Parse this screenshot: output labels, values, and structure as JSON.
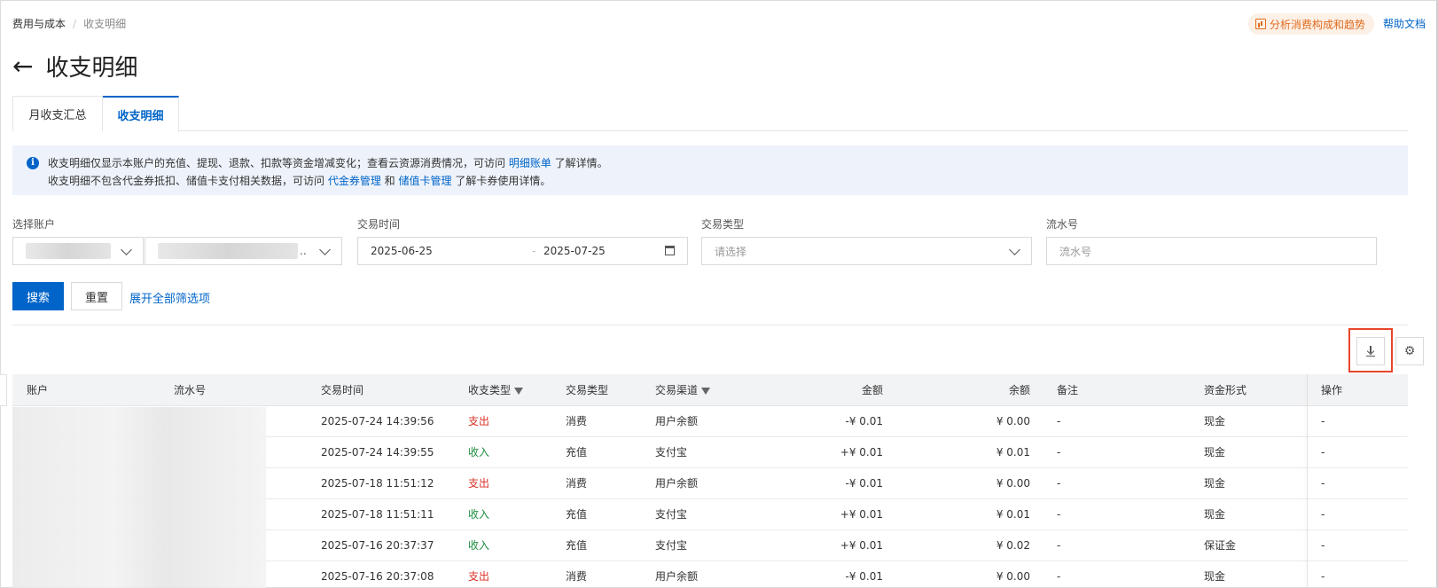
{
  "breadcrumb": {
    "parent": "费用与成本",
    "separator": "/",
    "current": "收支明细"
  },
  "header": {
    "analyze_label": "分析消费构成和趋势",
    "help_label": "帮助文档",
    "back_icon": "←",
    "title": "收支明细"
  },
  "tabs": [
    {
      "label": "月收支汇总",
      "active": false
    },
    {
      "label": "收支明细",
      "active": true
    }
  ],
  "notice": {
    "line1_before": "收支明细仅显示本账户的充值、提现、退款、扣款等资金增减变化；查看云资源消费情况，可访问 ",
    "line1_link": "明细账单",
    "line1_after": " 了解详情。",
    "line2_before": "收支明细不包含代金券抵扣、储值卡支付相关数据，可访问 ",
    "line2_link1": "代金券管理",
    "line2_mid": " 和 ",
    "line2_link2": "储值卡管理",
    "line2_after": " 了解卡券使用详情。"
  },
  "filters": {
    "account_label": "选择账户",
    "account_suffix": "..",
    "time_label": "交易时间",
    "start_date": "2025-06-25",
    "end_date": "2025-07-25",
    "range_sep": "-",
    "type_label": "交易类型",
    "type_placeholder": "请选择",
    "serial_label": "流水号",
    "serial_placeholder": "流水号"
  },
  "actions": {
    "search": "搜索",
    "reset": "重置",
    "expand": "展开全部筛选项"
  },
  "table": {
    "columns": [
      "账户",
      "流水号",
      "交易时间",
      "收支类型",
      "交易类型",
      "交易渠道",
      "金额",
      "余额",
      "备注",
      "资金形式",
      "操作"
    ],
    "rows": [
      {
        "time": "2025-07-24 14:39:56",
        "io": "支出",
        "io_type": "out",
        "type": "消费",
        "channel": "用户余额",
        "amount": "-¥ 0.01",
        "balance": "¥ 0.00",
        "remark": "-",
        "fund": "现金",
        "op": "-"
      },
      {
        "time": "2025-07-24 14:39:55",
        "io": "收入",
        "io_type": "in",
        "type": "充值",
        "channel": "支付宝",
        "amount": "+¥ 0.01",
        "balance": "¥ 0.01",
        "remark": "-",
        "fund": "现金",
        "op": "-"
      },
      {
        "time": "2025-07-18 11:51:12",
        "io": "支出",
        "io_type": "out",
        "type": "消费",
        "channel": "用户余额",
        "amount": "-¥ 0.01",
        "balance": "¥ 0.00",
        "remark": "-",
        "fund": "现金",
        "op": "-"
      },
      {
        "time": "2025-07-18 11:51:11",
        "io": "收入",
        "io_type": "in",
        "type": "充值",
        "channel": "支付宝",
        "amount": "+¥ 0.01",
        "balance": "¥ 0.01",
        "remark": "-",
        "fund": "现金",
        "op": "-"
      },
      {
        "time": "2025-07-16 20:37:37",
        "io": "收入",
        "io_type": "in",
        "type": "充值",
        "channel": "支付宝",
        "amount": "+¥ 0.01",
        "balance": "¥ 0.02",
        "remark": "-",
        "fund": "保证金",
        "op": "-"
      },
      {
        "time": "2025-07-16 20:37:08",
        "io": "支出",
        "io_type": "out",
        "type": "消费",
        "channel": "用户余额",
        "amount": "-¥ 0.01",
        "balance": "¥ 0.00",
        "remark": "-",
        "fund": "现金",
        "op": "-"
      }
    ]
  }
}
